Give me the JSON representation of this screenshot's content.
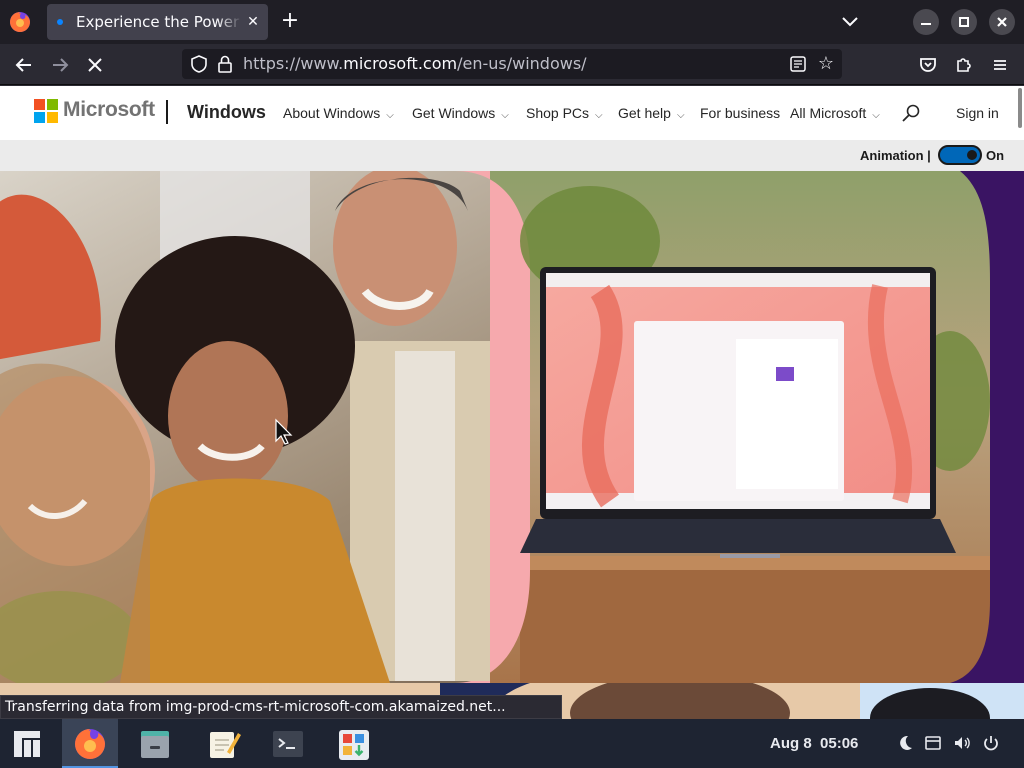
{
  "browser": {
    "tab_title": "Experience the Power of",
    "tab_close": "✕",
    "new_tab": "+",
    "url_prefix": "https://www.",
    "url_domain": "microsoft.com",
    "url_path": "/en-us/windows/",
    "status_text": "Transferring data from img-prod-cms-rt-microsoft-com.akamaized.net..."
  },
  "header": {
    "brand": "Microsoft",
    "product": "Windows",
    "nav": [
      {
        "label": "About Windows",
        "chevron": "⌵"
      },
      {
        "label": "Get Windows",
        "chevron": "⌵"
      },
      {
        "label": "Shop PCs",
        "chevron": "⌵"
      },
      {
        "label": "Get help",
        "chevron": "⌵"
      },
      {
        "label": "For business",
        "chevron": ""
      },
      {
        "label": "All Microsoft",
        "chevron": "⌵"
      }
    ],
    "sign_in": "Sign in"
  },
  "animation": {
    "label": "Animation |",
    "state": "On",
    "enabled": true
  },
  "taskbar": {
    "date": "Aug 8",
    "time": "05:06"
  },
  "colors": {
    "ms_red": "#f25022",
    "ms_green": "#7fba00",
    "ms_blue": "#00a4ef",
    "ms_yellow": "#ffb900",
    "accent": "#0067b8"
  }
}
